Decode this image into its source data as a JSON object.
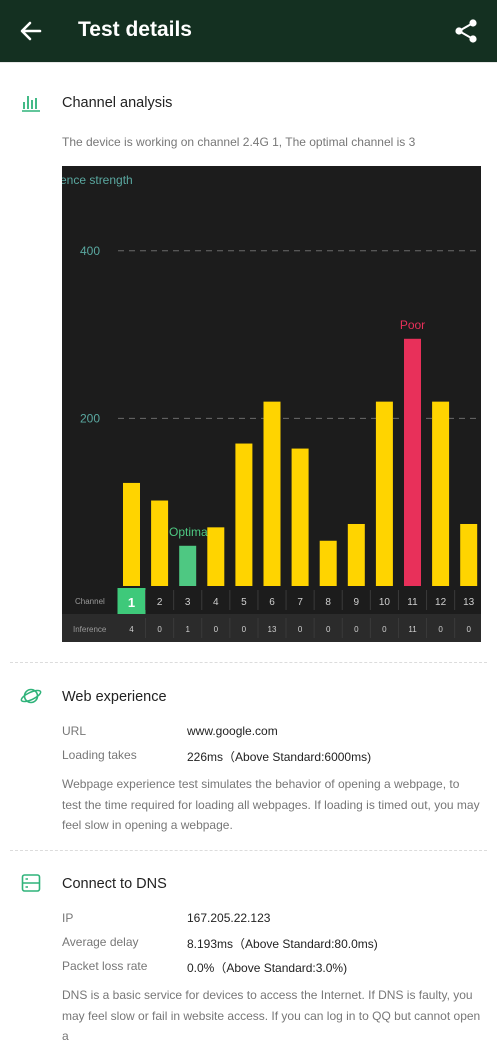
{
  "header": {
    "title": "Test details",
    "back_icon": "arrow-left-icon",
    "share_icon": "share-icon"
  },
  "channel": {
    "title": "Channel analysis",
    "icon": "bar-chart-icon",
    "description": "The device is working on channel 2.4G 1, The optimal channel is 3"
  },
  "chart_data": {
    "type": "bar",
    "ylabel": "ence strength",
    "ylim": [
      0,
      480
    ],
    "yticks": [
      200,
      400
    ],
    "categories": [
      "1",
      "2",
      "3",
      "4",
      "5",
      "6",
      "7",
      "8",
      "9",
      "10",
      "11",
      "12",
      "13"
    ],
    "values": [
      123,
      102,
      48,
      70,
      170,
      220,
      164,
      54,
      74,
      220,
      295,
      220,
      74
    ],
    "inference": [
      "4",
      "0",
      "1",
      "0",
      "0",
      "13",
      "0",
      "0",
      "0",
      "0",
      "11",
      "0",
      "0"
    ],
    "row_labels": {
      "channel": "Channel",
      "inference": "Inference"
    },
    "current_channel": "1",
    "optimal": {
      "channel": "3",
      "label": "Optimal"
    },
    "poor": {
      "channel": "11",
      "label": "Poor"
    },
    "colors": {
      "normal": "#ffd400",
      "optimal": "#4ec882",
      "poor": "#e8305a",
      "current": "#3ec97a",
      "axis_text": "#5aa8a0"
    }
  },
  "web": {
    "title": "Web experience",
    "icon": "planet-icon",
    "url_label": "URL",
    "url_value": "www.google.com",
    "loading_label": "Loading takes",
    "loading_value": "226ms（Above Standard:6000ms)",
    "paragraph": "Webpage experience test simulates the behavior of opening a webpage, to test the time required for loading all webpages. If loading is timed out, you may feel slow in opening a webpage."
  },
  "dns": {
    "title": "Connect to DNS",
    "icon": "server-icon",
    "ip_label": "IP",
    "ip_value": "167.205.22.123",
    "delay_label": "Average delay",
    "delay_value": "8.193ms（Above Standard:80.0ms)",
    "loss_label": "Packet loss rate",
    "loss_value": "0.0%（Above Standard:3.0%)",
    "paragraph": "DNS is a basic service for devices to access the Internet. If DNS is faulty, you may feel slow or fail in website access. If you can log in to QQ but cannot open a"
  },
  "colors": {
    "header_bg": "#143021",
    "accent": "#2fb37a"
  }
}
